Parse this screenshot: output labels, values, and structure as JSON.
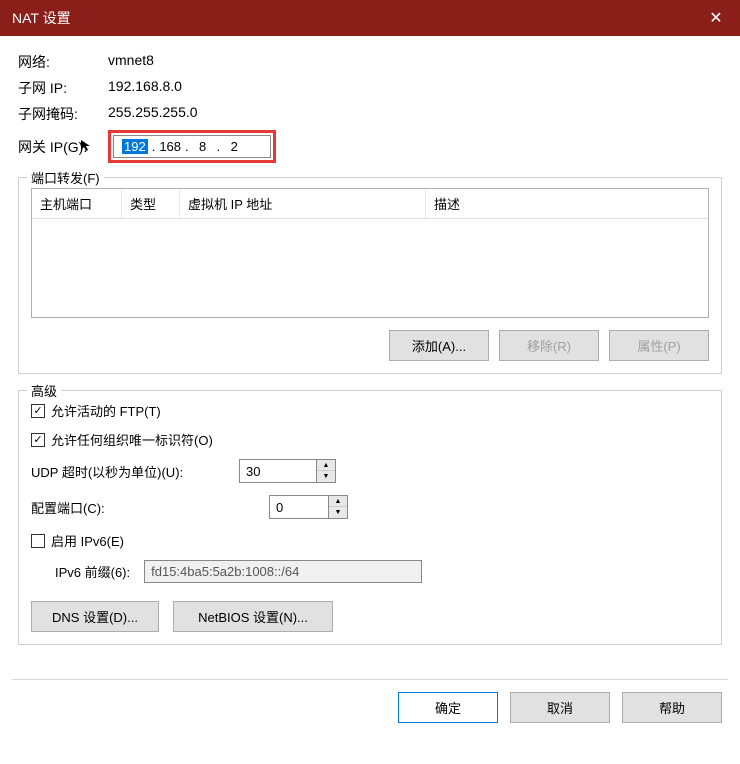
{
  "title": "NAT 设置",
  "network": {
    "label": "网络:",
    "value": "vmnet8"
  },
  "subnetIp": {
    "label": "子网 IP:",
    "value": "192.168.8.0"
  },
  "subnetMask": {
    "label": "子网掩码:",
    "value": "255.255.255.0"
  },
  "gateway": {
    "label": "网关 IP(G):",
    "seg1": "192",
    "seg2": "168",
    "seg3": "8",
    "seg4": "2"
  },
  "portForward": {
    "title": "端口转发(F)",
    "headers": {
      "hostPort": "主机端口",
      "type": "类型",
      "vmIp": "虚拟机 IP 地址",
      "desc": "描述"
    },
    "buttons": {
      "add": "添加(A)...",
      "remove": "移除(R)",
      "props": "属性(P)"
    }
  },
  "advanced": {
    "title": "高级",
    "allowFtp": "允许活动的 FTP(T)",
    "allowOui": "允许任何组织唯一标识符(O)",
    "udpTimeout": {
      "label": "UDP 超时(以秒为单位)(U):",
      "value": "30"
    },
    "configPort": {
      "label": "配置端口(C):",
      "value": "0"
    },
    "enableIpv6": "启用 IPv6(E)",
    "ipv6Prefix": {
      "label": "IPv6 前缀(6):",
      "value": "fd15:4ba5:5a2b:1008::/64"
    },
    "dnsBtn": "DNS 设置(D)...",
    "netbiosBtn": "NetBIOS 设置(N)..."
  },
  "footer": {
    "ok": "确定",
    "cancel": "取消",
    "help": "帮助"
  }
}
